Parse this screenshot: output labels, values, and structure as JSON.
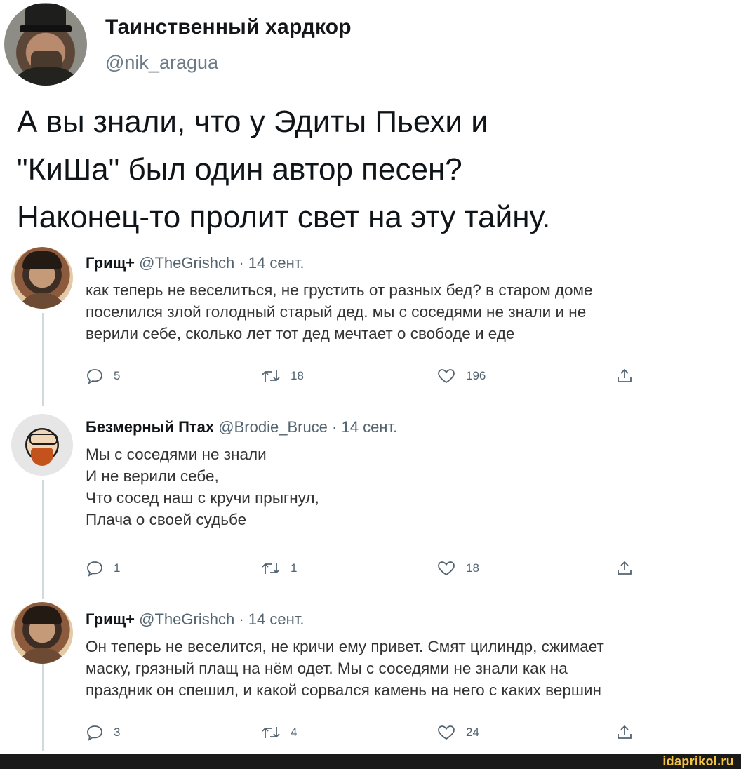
{
  "main_tweet": {
    "name": "Таинственный хардкор",
    "handle": "@nik_aragua",
    "text_lines": [
      "А вы знали, что у Эдиты Пьехи и",
      "\"КиШа\" был один автор песен?",
      "Наконец-то пролит свет на эту тайну."
    ]
  },
  "replies": [
    {
      "name": "Грищ+",
      "handle": "@TheGrishch",
      "date": "· 14 сент.",
      "text_lines": [
        "как теперь не веселиться, не грустить от разных бед? в старом доме",
        "поселился злой голодный старый дед. мы с соседями не знали и не",
        "верили себе, сколько лет тот дед мечтает о свободе и еде"
      ],
      "replies_count": "5",
      "retweets_count": "18",
      "likes_count": "196"
    },
    {
      "name": "Безмерный Птах",
      "handle": "@Brodie_Bruce",
      "date": "· 14 сент.",
      "text_lines": [
        "Мы с соседями не знали",
        "И не верили себе,",
        "Что сосед наш с кручи прыгнул,",
        "Плача о своей судьбе"
      ],
      "replies_count": "1",
      "retweets_count": "1",
      "likes_count": "18"
    },
    {
      "name": "Грищ+",
      "handle": "@TheGrishch",
      "date": "· 14 сент.",
      "text_lines": [
        "Он теперь не веселится, не кричи ему привет. Смят цилиндр, сжимает",
        "маску, грязный плащ на нём одет. Мы с соседями не знали как на",
        "праздник он спешил, и какой сорвался камень на него с каких вершин"
      ],
      "replies_count": "3",
      "retweets_count": "4",
      "likes_count": "24"
    }
  ],
  "icons": {
    "reply": "reply-icon",
    "retweet": "retweet-icon",
    "like": "like-icon",
    "share": "share-icon"
  },
  "watermark": "idaprikol.ru",
  "colors": {
    "text": "#0f1419",
    "secondary": "#536471",
    "thread_line": "#cfd9de",
    "watermark": "#f5c542"
  }
}
